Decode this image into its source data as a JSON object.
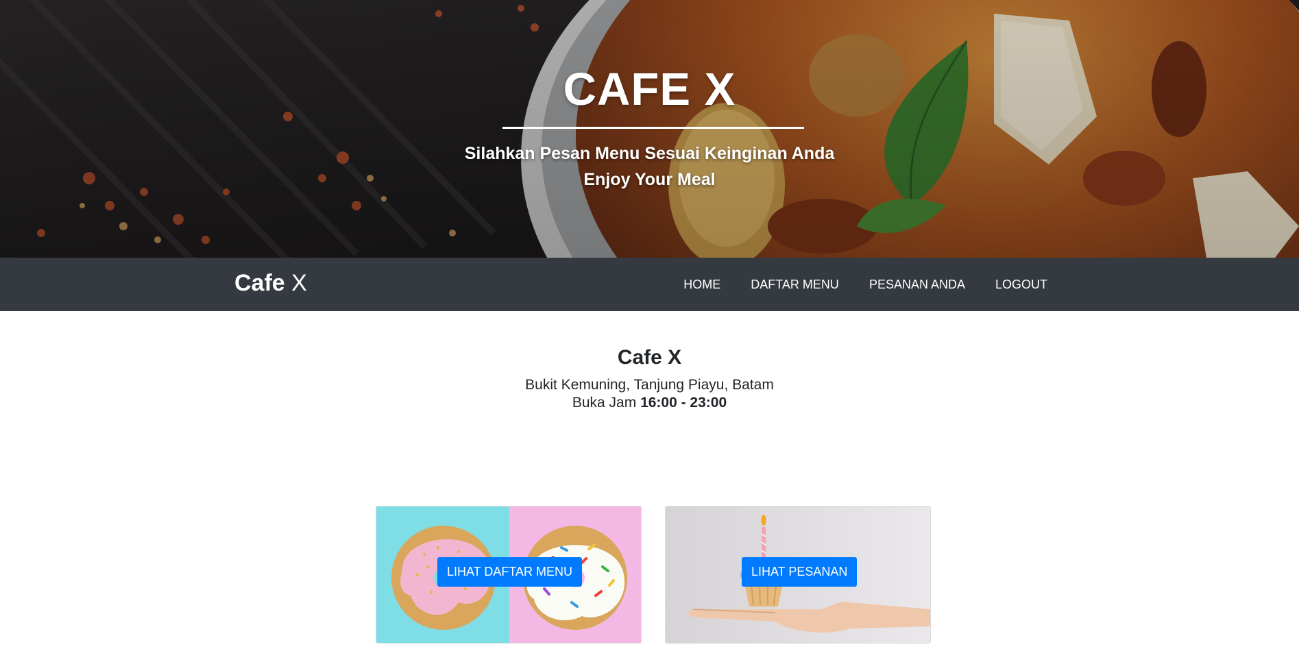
{
  "hero": {
    "title": "CAFE X",
    "subtitle_1": "Silahkan Pesan Menu Sesuai Keinginan Anda",
    "subtitle_2": "Enjoy Your Meal"
  },
  "navbar": {
    "brand_bold": "Cafe",
    "brand_light": "X",
    "links": [
      "HOME",
      "DAFTAR MENU",
      "PESANAN ANDA",
      "LOGOUT"
    ]
  },
  "info": {
    "title": "Cafe X",
    "address": "Bukit Kemuning, Tanjung Piayu, Batam",
    "hours_label": "Buka Jam",
    "hours_value": "16:00 - 23:00"
  },
  "cards": [
    {
      "button_label": "LIHAT DAFTAR MENU",
      "image": "donuts-photo"
    },
    {
      "button_label": "LIHAT PESANAN",
      "image": "cupcake-in-hand-photo"
    }
  ],
  "colors": {
    "navbar_bg": "#343a40",
    "primary_button": "#007bff",
    "text_dark": "#212529"
  }
}
